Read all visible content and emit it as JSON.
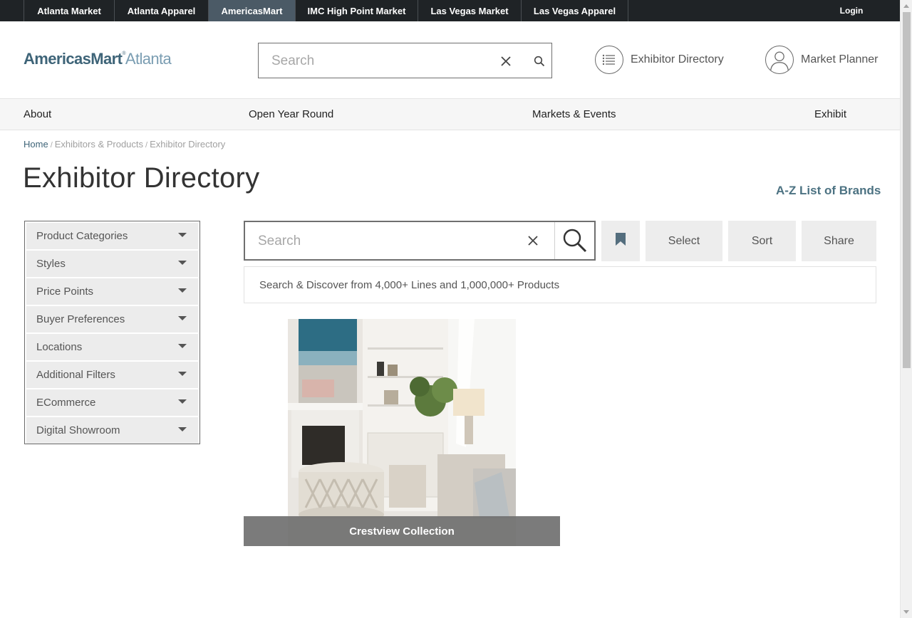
{
  "topbar": {
    "markets": [
      {
        "label": "Atlanta Market",
        "active": false
      },
      {
        "label": "Atlanta Apparel",
        "active": false
      },
      {
        "label": "AmericasMart",
        "active": true
      },
      {
        "label": "IMC High Point Market",
        "active": false
      },
      {
        "label": "Las Vegas Market",
        "active": false
      },
      {
        "label": "Las Vegas Apparel",
        "active": false
      }
    ],
    "login": "Login"
  },
  "header": {
    "logo_part1": "AmericasMart",
    "logo_reg": "®",
    "logo_part2": "Atlanta",
    "search_placeholder": "Search",
    "exhibitor_directory": "Exhibitor Directory",
    "market_planner": "Market Planner"
  },
  "nav": [
    "About",
    "Open Year Round",
    "Markets & Events",
    "Exhibit"
  ],
  "breadcrumb": {
    "home": "Home",
    "sep": "/",
    "level2": "Exhibitors & Products",
    "level3": "Exhibitor Directory"
  },
  "page": {
    "title": "Exhibitor Directory",
    "az_link": "A-Z List of Brands"
  },
  "filters": [
    "Product Categories",
    "Styles",
    "Price Points",
    "Buyer Preferences",
    "Locations",
    "Additional Filters",
    "ECommerce",
    "Digital Showroom"
  ],
  "results": {
    "search_placeholder": "Search",
    "select_label": "Select",
    "sort_label": "Sort",
    "share_label": "Share",
    "discover_text": "Search & Discover from 4,000+ Lines and 1,000,000+ Products"
  },
  "cards": [
    {
      "title": "Crestview Collection"
    }
  ],
  "colors": {
    "topbar": "#1f2326",
    "active_market": "#4b5a66",
    "brand": "#3e6478",
    "brand_light": "#7a9db2",
    "link_accent": "#4c7282"
  }
}
